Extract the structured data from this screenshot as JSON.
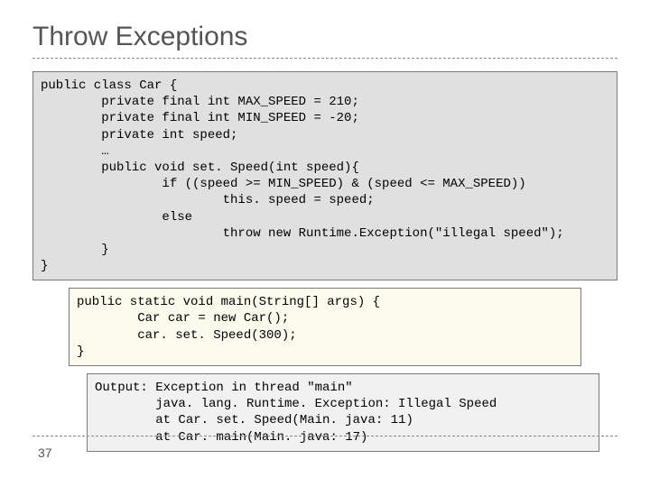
{
  "title": "Throw Exceptions",
  "pageNumber": "37",
  "codeBlock1": "public class Car {\n        private final int MAX_SPEED = 210;\n        private final int MIN_SPEED = -20;\n        private int speed;\n        …\n        public void set. Speed(int speed){\n                if ((speed >= MIN_SPEED) & (speed <= MAX_SPEED))\n                        this. speed = speed;\n                else\n                        throw new Runtime.Exception(\"illegal speed\");\n        }\n}",
  "codeBlock2": "public static void main(String[] args) {\n        Car car = new Car();\n        car. set. Speed(300);\n}",
  "codeBlock3": "Output: Exception in thread \"main\"\n        java. lang. Runtime. Exception: Illegal Speed\n        at Car. set. Speed(Main. java: 11)\n        at Car. main(Main. java: 17)"
}
